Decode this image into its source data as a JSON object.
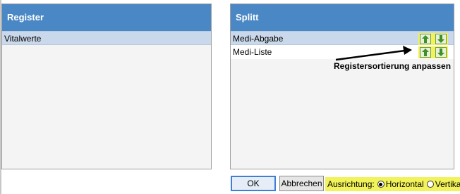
{
  "register_panel": {
    "title": "Register",
    "items": [
      {
        "label": "Vitalwerte",
        "selected": true
      }
    ]
  },
  "splitt_panel": {
    "title": "Splitt",
    "items": [
      {
        "label": "Medi-Abgabe",
        "selected": true
      },
      {
        "label": "Medi-Liste",
        "selected": false
      }
    ]
  },
  "icons": {
    "up": "arrow-up-icon",
    "down": "arrow-down-icon"
  },
  "annotation": {
    "text": "Registersortierung anpassen"
  },
  "footer": {
    "ok_label": "OK",
    "cancel_label": "Abbrechen",
    "orientation_label": "Ausrichtung:",
    "orientation_options": [
      "Horizontal",
      "Vertikal"
    ],
    "orientation_selected": "Horizontal"
  },
  "colors": {
    "header": "#4a87c5",
    "highlight": "#f2f25a",
    "arrow": "#3f8f2a"
  }
}
